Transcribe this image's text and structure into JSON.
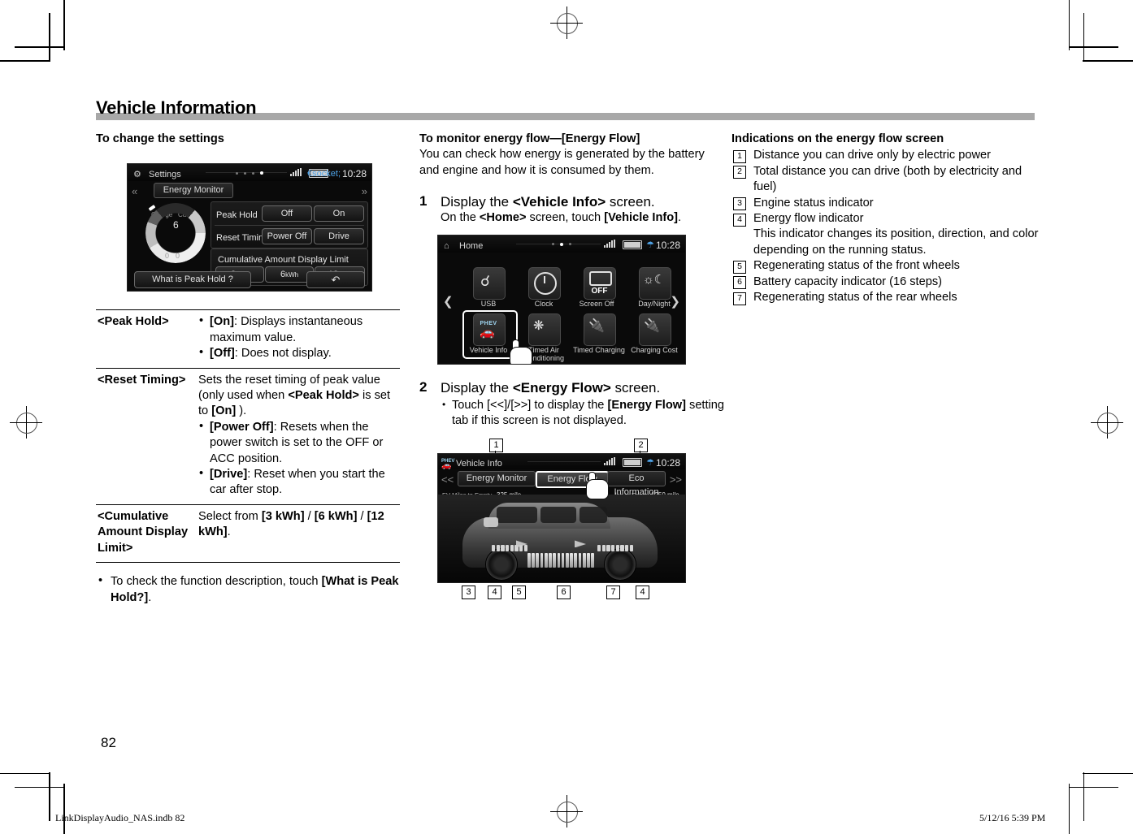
{
  "header": {
    "title": "Vehicle Information"
  },
  "col1": {
    "subhead": "To change the settings",
    "screenshot": {
      "status": {
        "title": "Settings",
        "clock": "10:28",
        "gear_icon": "gear-icon",
        "bt_icon": "bluetooth-icon"
      },
      "tab": "Energy Monitor",
      "dial": {
        "left_label": "Charge",
        "right_label": "Cumul.",
        "center_value": "6",
        "zero_left": "0",
        "zero_right": "0"
      },
      "rows": [
        {
          "label": "Peak Hold",
          "buttons": [
            "Off",
            "On"
          ]
        },
        {
          "label": "Reset Timing",
          "buttons": [
            "Power Off",
            "Drive"
          ]
        }
      ],
      "limit_label": "Cumulative Amount Display Limit",
      "limit_buttons": [
        {
          "v": "3",
          "u": "kWh"
        },
        {
          "v": "6",
          "u": "kWh"
        },
        {
          "v": "12",
          "u": "kWh"
        }
      ],
      "help_button": "What is Peak Hold ?",
      "back_icon": "back-arrow-icon"
    },
    "table": [
      {
        "term": "<Peak Hold>",
        "bullets": [
          {
            "key": "[On]",
            "text": ": Displays instantaneous maximum value."
          },
          {
            "key": "[Off]",
            "text": ": Does not display."
          }
        ],
        "lead": ""
      },
      {
        "term": "<Reset Timing>",
        "lead_parts": [
          "Sets the reset timing of peak value (only used when ",
          "<Peak Hold>",
          " is set to ",
          "[On]",
          " )."
        ],
        "bullets": [
          {
            "key": "[Power Off]",
            "text": ": Resets when the power switch is set to the OFF or ACC position."
          },
          {
            "key": "[Drive]",
            "text": ": Reset when you start the car after stop."
          }
        ]
      },
      {
        "term": "<Cumulative Amount Display Limit>",
        "lead_plain": "Select from ",
        "options": [
          "[3 kWh]",
          "[6 kWh]",
          "[12 kWh]"
        ],
        "lead_tail": "."
      }
    ],
    "note": {
      "pre": "To check the function description, touch ",
      "bold": "[What is Peak Hold?]",
      "post": "."
    }
  },
  "col2": {
    "subhead": "To monitor energy flow—[Energy Flow]",
    "intro": "You can check how energy is generated by the battery and engine and how it is consumed by them.",
    "step1": {
      "num": "1",
      "line1_pre": "Display the ",
      "line1_bold": "<Vehicle Info>",
      "line1_post": " screen.",
      "line2_pre": "On the ",
      "line2_bold1": "<Home>",
      "line2_mid": " screen, touch ",
      "line2_bold2": "[Vehicle Info]",
      "line2_post": "."
    },
    "home_screenshot": {
      "status": {
        "title": "Home",
        "clock": "10:28",
        "home_icon": "home-icon"
      },
      "tiles_row1": [
        {
          "label": "USB",
          "icon": "usb-icon"
        },
        {
          "label": "Clock",
          "icon": "clock-icon"
        },
        {
          "label": "Screen Off",
          "icon": "screen-off-icon",
          "badge": "OFF"
        },
        {
          "label": "Day/Night",
          "icon": "day-night-icon"
        }
      ],
      "tiles_row2": [
        {
          "label": "Vehicle Info",
          "icon": "phev-car-icon",
          "badge": "PHEV",
          "selected": true
        },
        {
          "label": "Timed Air Conditioning",
          "icon": "fan-timer-icon"
        },
        {
          "label": "Timed Charging",
          "icon": "plug-timer-icon"
        },
        {
          "label": "Charging Cost",
          "icon": "plug-cost-icon"
        }
      ],
      "arrow_left": "chevron-left-icon",
      "arrow_right": "chevron-right-icon",
      "hand": "touch-hand-icon"
    },
    "step2": {
      "num": "2",
      "line1_pre": "Display the ",
      "line1_bold": "<Energy Flow>",
      "line1_post": " screen.",
      "sub_pre": "Touch ",
      "sub_keys": "[<<]/[>>]",
      "sub_mid": " to display the ",
      "sub_bold": "[Energy Flow]",
      "sub_post": " setting tab if this screen is not displayed."
    },
    "flow_screenshot": {
      "status": {
        "title": "Vehicle Info",
        "clock": "10:28",
        "badge": "PHEV",
        "car_icon": "car-icon"
      },
      "tabs": [
        "Energy Monitor",
        "Energy Flow",
        "Eco Information"
      ],
      "active_tab": "Energy Flow",
      "arrow_left": "<<",
      "arrow_right": ">>",
      "ev_label": "EV Miles to Empty",
      "ev_value": "325 mile",
      "total_label": "les to Empty",
      "total_value": "1250 mile",
      "hand": "touch-hand-icon",
      "callouts_top": [
        "1",
        "2"
      ],
      "callouts_bottom": [
        "3",
        "4",
        "5",
        "6",
        "7",
        "4"
      ]
    }
  },
  "col3": {
    "subhead": "Indications on the energy flow screen",
    "items": [
      {
        "num": "1",
        "text": "Distance you can drive only by electric power"
      },
      {
        "num": "2",
        "text": "Total distance you can drive (both by electricity and fuel)"
      },
      {
        "num": "3",
        "text": "Engine status indicator"
      },
      {
        "num": "4",
        "text": "Energy flow indicator",
        "cont": "This indicator changes its position, direction, and color depending on the running status."
      },
      {
        "num": "5",
        "text": "Regenerating status of the front wheels"
      },
      {
        "num": "6",
        "text": "Battery capacity indicator (16 steps)"
      },
      {
        "num": "7",
        "text": "Regenerating status of the rear wheels"
      }
    ]
  },
  "footer": {
    "page_number": "82",
    "file_name": "LinkDisplayAudio_NAS.indb   82",
    "timestamp": "5/12/16   5:39 PM"
  }
}
